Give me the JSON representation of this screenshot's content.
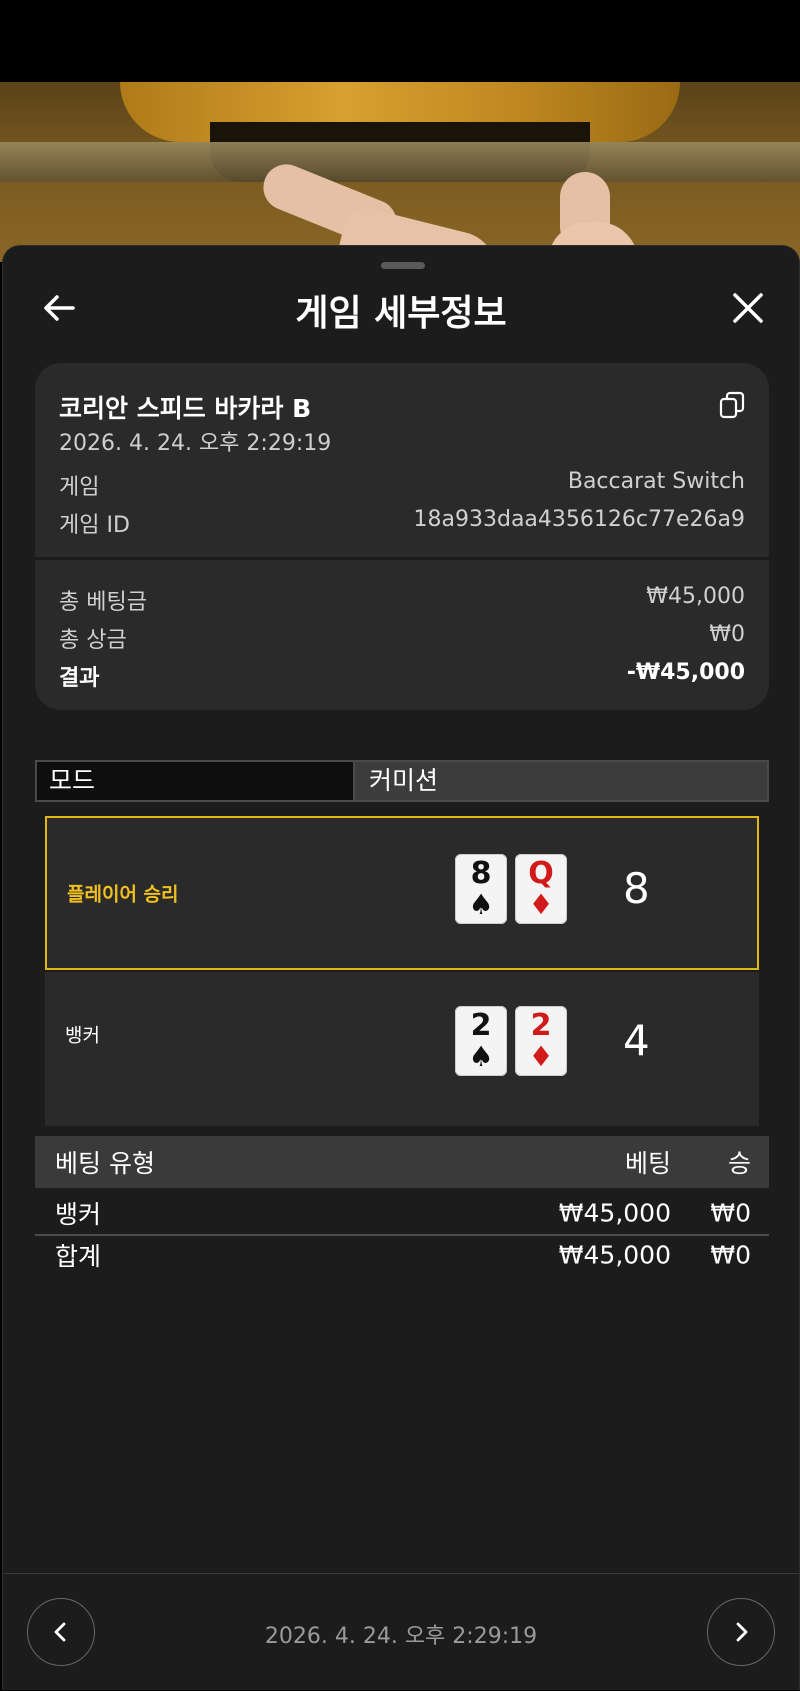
{
  "header": {
    "title": "게임 세부정보"
  },
  "game": {
    "table_name": "코리안 스피드 바카라 B",
    "datetime": "2026. 4. 24. 오후 2:29:19",
    "game_label": "게임",
    "game_value": "Baccarat Switch",
    "game_id_label": "게임 ID",
    "game_id_value": "18a933daa4356126c77e26a9"
  },
  "summary": {
    "total_bet_label": "총 베팅금",
    "total_bet_value": "₩45,000",
    "total_win_label": "총 상금",
    "total_win_value": "₩0",
    "result_label": "결과",
    "result_value": "-₩45,000"
  },
  "mode_tabs": {
    "mode": "모드",
    "commission": "커미션"
  },
  "hands": [
    {
      "label": "플레이어 승리",
      "cards": [
        {
          "rank": "8",
          "suit": "♠",
          "color": "#111111"
        },
        {
          "rank": "Q",
          "suit": "♦",
          "color": "#d11a1a"
        }
      ],
      "score": "8",
      "winner": true
    },
    {
      "label": "뱅커",
      "cards": [
        {
          "rank": "2",
          "suit": "♠",
          "color": "#111111"
        },
        {
          "rank": "2",
          "suit": "♦",
          "color": "#d11a1a"
        }
      ],
      "score": "4",
      "winner": false
    }
  ],
  "bets": {
    "headers": {
      "type": "베팅 유형",
      "bet": "베팅",
      "win": "승"
    },
    "rows": [
      {
        "type": "뱅커",
        "bet": "₩45,000",
        "win": "₩0"
      },
      {
        "type": "합계",
        "bet": "₩45,000",
        "win": "₩0"
      }
    ]
  },
  "footer": {
    "datetime": "2026. 4. 24. 오후 2:29:19"
  },
  "colors": {
    "winner_border": "#e1b714",
    "winner_text": "#f0c020",
    "sheet_bg": "#1c1c1c",
    "card_bg": "#2a2a2a"
  },
  "icons": {
    "back": "arrow-left-icon",
    "close": "close-icon",
    "copy": "copy-icon",
    "prev": "chevron-left-icon",
    "next": "chevron-right-icon"
  }
}
